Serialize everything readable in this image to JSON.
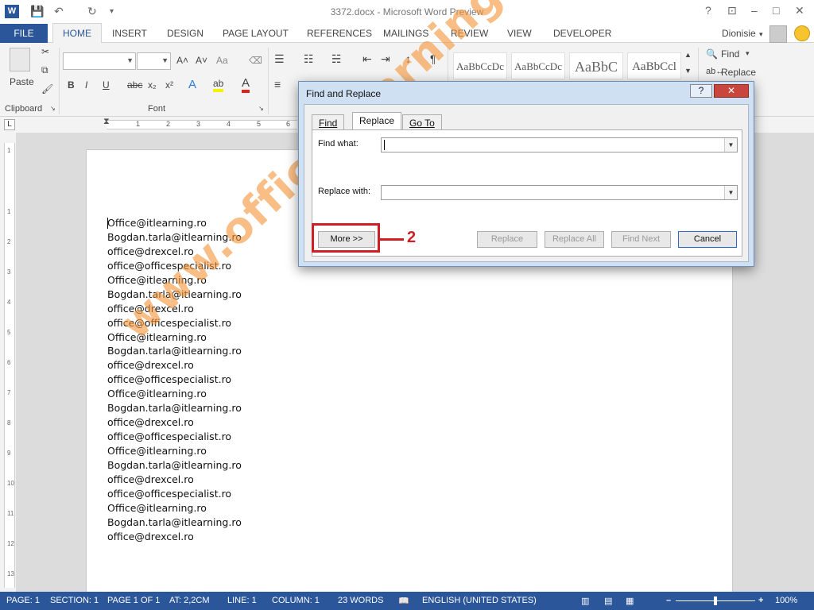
{
  "window": {
    "title": "3372.docx - Microsoft Word Preview",
    "app_icon": "W",
    "help_label": "?",
    "minimize": "–",
    "restore": "□",
    "close": "✕"
  },
  "quick_access": {
    "save": "💾",
    "undo": "↶",
    "redo": "↻",
    "more": "▾"
  },
  "tabs": {
    "file": "FILE",
    "items": [
      "HOME",
      "INSERT",
      "DESIGN",
      "PAGE LAYOUT",
      "REFERENCES",
      "MAILINGS",
      "REVIEW",
      "VIEW",
      "DEVELOPER"
    ],
    "active": "HOME",
    "user": "Dionisie",
    "user_arrow": "▾"
  },
  "ribbon": {
    "clipboard": {
      "label": "Clipboard",
      "paste": "Paste"
    },
    "font": {
      "label": "Font",
      "bold": "B",
      "italic": "I",
      "underline": "U",
      "strike": "abc",
      "sub": "x₂",
      "sup": "x²",
      "grow": "A˄",
      "shrink": "A˅",
      "case": "Aa",
      "clear": "⌫",
      "texteffect": "A",
      "highlight": "ab",
      "fontcolor": "A"
    },
    "paragraph": {
      "bullets": "☰",
      "numbering": "☷",
      "multilevel": "☵",
      "decrease": "⇤",
      "increase": "⇥",
      "sort": "↕",
      "pilcrow": "¶",
      "align": "≡"
    },
    "styles": [
      "AaBbCcDc",
      "AaBbCcDc",
      "AaBbC",
      "AaBbCcl"
    ],
    "editing": {
      "find": "Find",
      "replace": "Replace",
      "find_arrow": "▾"
    }
  },
  "ruler": {
    "corner": "L",
    "h_numbers": [
      "1",
      "2",
      "3",
      "4",
      "5",
      "6"
    ],
    "v_numbers": [
      "1",
      "1",
      "2",
      "3",
      "4",
      "5",
      "6",
      "7",
      "8",
      "9",
      "10",
      "11",
      "12",
      "13"
    ]
  },
  "document": {
    "lines": [
      "Office@itlearning.ro",
      "Bogdan.tarla@itlearning.ro",
      "office@drexcel.ro",
      "office@officespecialist.ro",
      "Office@itlearning.ro",
      "Bogdan.tarla@itlearning.ro",
      "office@drexcel.ro",
      "office@officespecialist.ro",
      "Office@itlearning.ro",
      "Bogdan.tarla@itlearning.ro",
      "office@drexcel.ro",
      "office@officespecialist.ro",
      "Office@itlearning.ro",
      "Bogdan.tarla@itlearning.ro",
      "office@drexcel.ro",
      "office@officespecialist.ro",
      "Office@itlearning.ro",
      "Bogdan.tarla@itlearning.ro",
      "office@drexcel.ro",
      "office@officespecialist.ro",
      "Office@itlearning.ro",
      "Bogdan.tarla@itlearning.ro",
      "office@drexcel.ro"
    ]
  },
  "dialog": {
    "title": "Find and Replace",
    "help": "?",
    "close": "✕",
    "tabs": [
      "Find",
      "Replace",
      "Go To"
    ],
    "active_tab": "Replace",
    "find_label": "Find what:",
    "find_value": "",
    "replace_label": "Replace with:",
    "replace_value": "",
    "dropdown": "▼",
    "buttons": {
      "more": "More >>",
      "replace": "Replace",
      "replace_all": "Replace All",
      "find_next": "Find Next",
      "cancel": "Cancel"
    },
    "callout": "2"
  },
  "statusbar": {
    "page": "PAGE: 1",
    "section": "SECTION: 1",
    "page_of": "PAGE 1 OF 1",
    "at": "AT: 2,2CM",
    "line": "LINE: 1",
    "column": "COLUMN: 1",
    "words": "23 WORDS",
    "language": "ENGLISH (UNITED STATES)",
    "zoom": "100%",
    "zoom_minus": "–",
    "zoom_plus": "+"
  },
  "watermark": "www.office-learning.ro",
  "colors": {
    "accent": "#2b579a",
    "callout": "#cf1f25",
    "watermark": "#f3963c"
  }
}
